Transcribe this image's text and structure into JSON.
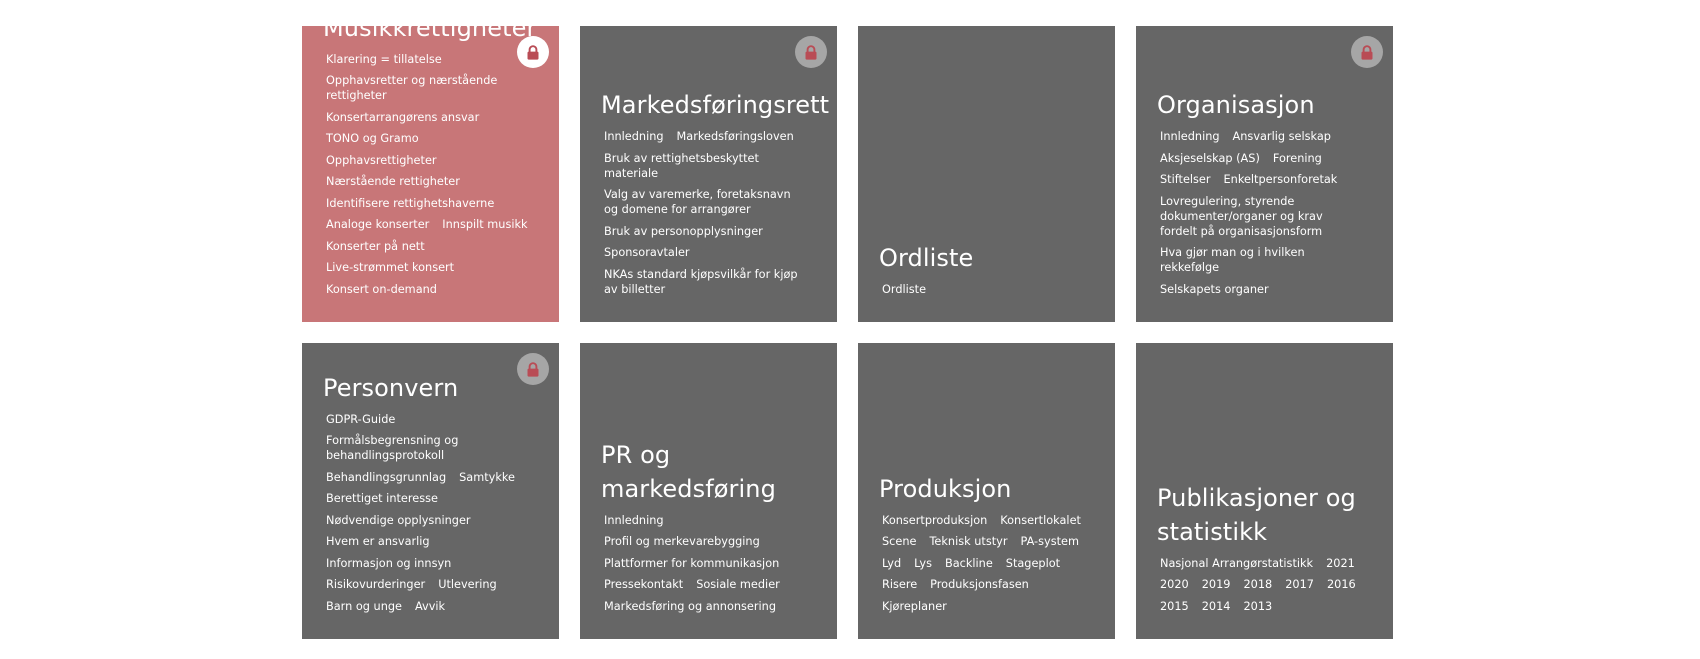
{
  "colors": {
    "card_background": "#666666",
    "card_active_background": "#c87678",
    "lock_badge": "#a6a6a6",
    "lock_badge_active": "#ffffff",
    "lock_icon": "#b94c55"
  },
  "cards": [
    {
      "title": "Musikkrettigheter",
      "locked": true,
      "active": true,
      "links": [
        "Klarering = tillatelse",
        "Opphavsretter og nærstående rettigheter",
        "Konsertarrangørens ansvar",
        "TONO og Gramo",
        "Opphavsrettigheter",
        "Nærstående rettigheter",
        "Identifisere rettighetshaverne",
        "Analoge konserter",
        "Innspilt musikk",
        "Konserter på nett",
        "Live-strømmet konsert",
        "Konsert on-demand"
      ]
    },
    {
      "title": "Markedsføringsrett",
      "locked": true,
      "active": false,
      "links": [
        "Innledning",
        "Markedsføringsloven",
        "Bruk av rettighetsbeskyttet materiale",
        "Valg av varemerke, foretaksnavn og domene for arrangører",
        "Bruk av personopplysninger",
        "Sponsoravtaler",
        "NKAs standard kjøpsvilkår for kjøp av billetter"
      ]
    },
    {
      "title": "Ordliste",
      "locked": false,
      "active": false,
      "links": [
        "Ordliste"
      ]
    },
    {
      "title": "Organisasjon",
      "locked": true,
      "active": false,
      "links": [
        "Innledning",
        "Ansvarlig selskap",
        "Aksjeselskap (AS)",
        "Forening",
        "Stiftelser",
        "Enkeltpersonforetak",
        "Lovregulering, styrende dokumenter/organer og krav fordelt på organisasjonsform",
        "Hva gjør man og i hvilken rekkefølge",
        "Selskapets organer"
      ]
    },
    {
      "title": "Personvern",
      "locked": true,
      "active": false,
      "links": [
        "GDPR-Guide",
        "Formålsbegrensning og behandlingsprotokoll",
        "Behandlingsgrunnlag",
        "Samtykke",
        "Berettiget interesse",
        "Nødvendige opplysninger",
        "Hvem er ansvarlig",
        "Informasjon og innsyn",
        "Risikovurderinger",
        "Utlevering",
        "Barn og unge",
        "Avvik"
      ]
    },
    {
      "title": "PR og markedsføring",
      "locked": false,
      "active": false,
      "links": [
        "Innledning",
        "Profil og merkevarebygging",
        "Plattformer for kommunikasjon",
        "Pressekontakt",
        "Sosiale medier",
        "Markedsføring og annonsering"
      ]
    },
    {
      "title": "Produksjon",
      "locked": false,
      "active": false,
      "links": [
        "Konsertproduksjon",
        "Konsertlokalet",
        "Scene",
        "Teknisk utstyr",
        "PA-system",
        "Lyd",
        "Lys",
        "Backline",
        "Stageplot",
        "Risere",
        "Produksjonsfasen",
        "Kjøreplaner"
      ]
    },
    {
      "title": "Publikasjoner og statistikk",
      "locked": false,
      "active": false,
      "links": [
        "Nasjonal Arrangørstatistikk",
        "2021",
        "2020",
        "2019",
        "2018",
        "2017",
        "2016",
        "2015",
        "2014",
        "2013"
      ]
    }
  ]
}
